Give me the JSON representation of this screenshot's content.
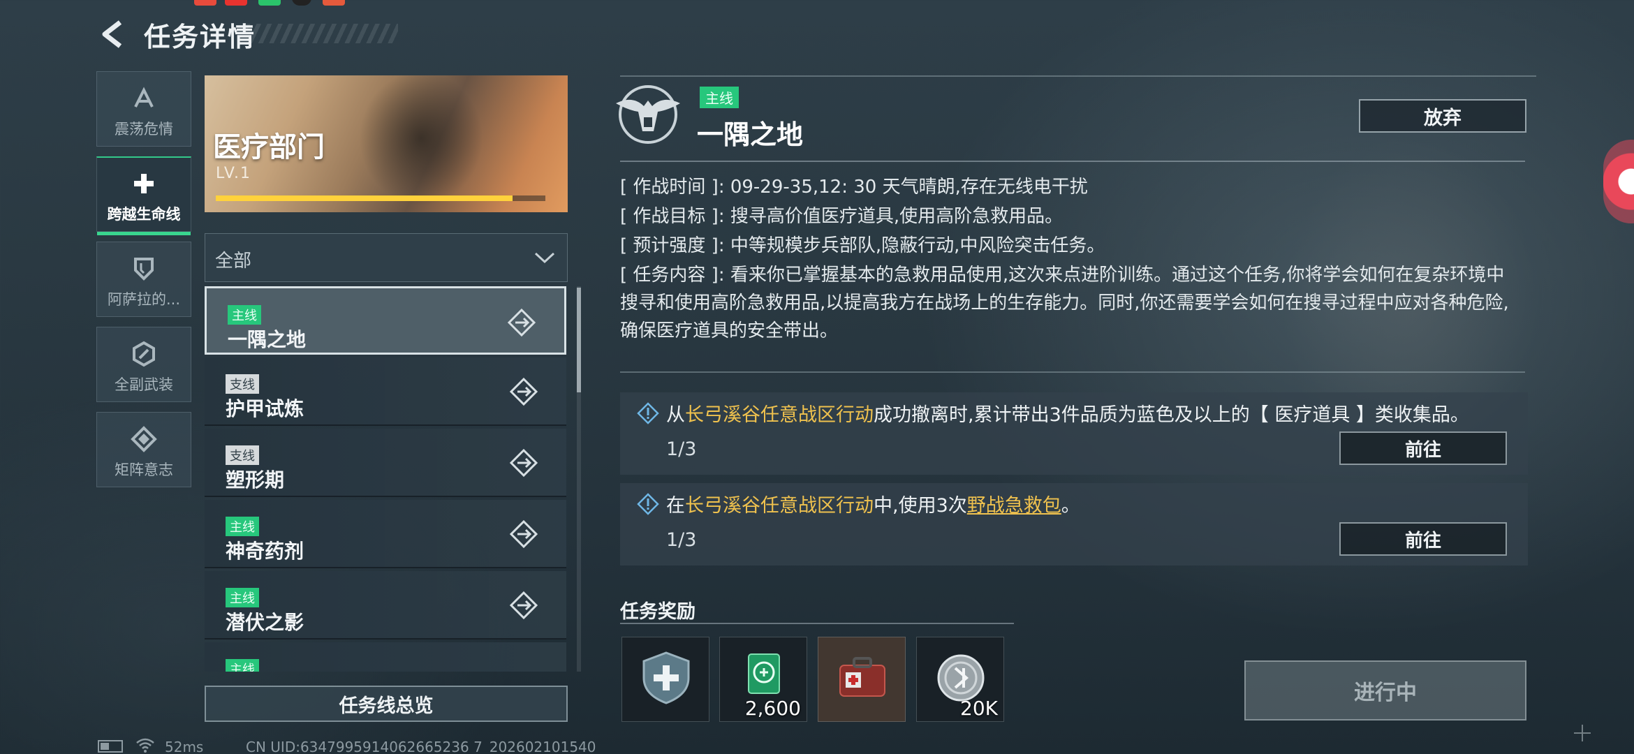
{
  "header": {
    "title": "任务详情",
    "back_icon": "back-arrow-icon"
  },
  "categories": [
    {
      "label": "震荡危情",
      "icon": "alpha-icon",
      "active": false
    },
    {
      "label": "跨越生命线",
      "icon": "medical-cross-icon",
      "active": true
    },
    {
      "label": "阿萨拉的...",
      "icon": "shield-icon",
      "active": false
    },
    {
      "label": "全副武装",
      "icon": "hex-emblem-icon",
      "active": false
    },
    {
      "label": "矩阵意志",
      "icon": "diamond-emblem-icon",
      "active": false
    }
  ],
  "department": {
    "name": "医疗部门",
    "level": "LV.1",
    "progress": 0.9
  },
  "filter": {
    "selected": "全部"
  },
  "missions": [
    {
      "tag": "主线",
      "type": "main",
      "name": "一隅之地",
      "selected": true
    },
    {
      "tag": "支线",
      "type": "side",
      "name": "护甲试炼",
      "selected": false
    },
    {
      "tag": "支线",
      "type": "side",
      "name": "塑形期",
      "selected": false
    },
    {
      "tag": "主线",
      "type": "main",
      "name": "神奇药剂",
      "selected": false
    },
    {
      "tag": "主线",
      "type": "main",
      "name": "潜伏之影",
      "selected": false
    },
    {
      "tag": "主线",
      "type": "main",
      "name": "",
      "selected": false
    }
  ],
  "overview_button": "任务线总览",
  "detail": {
    "tag": "主线",
    "title": "一隅之地",
    "abandon_button": "放弃",
    "info": [
      {
        "key": "[ 作战时间 ]:",
        "value": "09-29-35,12: 30 天气晴朗,存在无线电干扰"
      },
      {
        "key": "[ 作战目标 ]:",
        "value": "搜寻高价值医疗道具,使用高阶急救用品。"
      },
      {
        "key": "[ 预计强度 ]:",
        "value": "中等规模步兵部队,隐蔽行动,中风险突击任务。"
      }
    ],
    "content_key": "[ 任务内容 ]:",
    "content_value": "看来你已掌握基本的急救用品使用,这次来点进阶训练。通过这个任务,你将学会如何在复杂环境中搜寻和使用高阶急救用品,以提高我方在战场上的生存能力。同时,你还需要学会如何在搜寻过程中应对各种危险,确保医疗道具的安全带出。"
  },
  "objectives": [
    {
      "prefix": "从",
      "highlight": "长弓溪谷任意战区行动",
      "mid": "成功撤离时,累计带出3件品质为蓝色及以上的【 医疗道具 】类收集品。",
      "link": "",
      "suffix": "",
      "progress": "1/3",
      "button": "前往"
    },
    {
      "prefix": "在",
      "highlight": "长弓溪谷任意战区行动",
      "mid": "中,使用3次",
      "link": "野战急救包",
      "suffix": "。",
      "progress": "1/3",
      "button": "前往"
    }
  ],
  "rewards": {
    "title": "任务奖励",
    "items": [
      {
        "icon": "medical-shield-icon",
        "qty": ""
      },
      {
        "icon": "green-token-icon",
        "qty": "2,600"
      },
      {
        "icon": "medkit-icon",
        "qty": ""
      },
      {
        "icon": "silver-coin-icon",
        "qty": "20K"
      }
    ]
  },
  "status_button": "进行中",
  "footer": {
    "ping": "52ms",
    "uid": "CN UID:6347995914062665236 7_202602101540"
  },
  "colors": {
    "main_tag": "#27c77c",
    "side_tag": "#d6dadc",
    "highlight": "#f0c24e",
    "active_tab": "#39d68f"
  }
}
